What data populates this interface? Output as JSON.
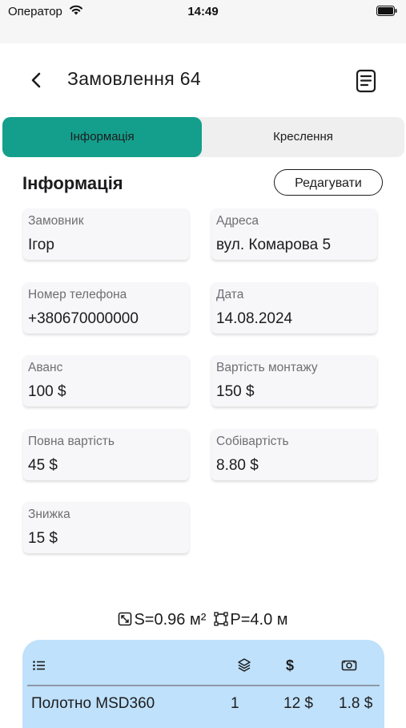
{
  "status_bar": {
    "carrier": "Оператор",
    "time": "14:49"
  },
  "header": {
    "title": "Замовлення 64"
  },
  "tabs": [
    {
      "label": "Інформація",
      "active": true
    },
    {
      "label": "Креслення",
      "active": false
    }
  ],
  "info": {
    "title": "Інформація",
    "edit_label": "Редагувати",
    "fields": {
      "customer": {
        "label": "Замовник",
        "value": "Ігор"
      },
      "address": {
        "label": "Адреса",
        "value": "вул. Комарова 5"
      },
      "phone": {
        "label": "Номер телефона",
        "value": "+380670000000"
      },
      "date": {
        "label": "Дата",
        "value": "14.08.2024"
      },
      "advance": {
        "label": "Аванс",
        "value": "100 $"
      },
      "install_cost": {
        "label": "Вартість монтажу",
        "value": "150 $"
      },
      "total_cost": {
        "label": "Повна вартість",
        "value": "45 $"
      },
      "cost_price": {
        "label": "Собівартість",
        "value": "8.80 $"
      },
      "discount": {
        "label": "Знижка",
        "value": "15 $"
      }
    }
  },
  "metrics": {
    "area": "S=0.96 м²",
    "perimeter": "P=4.0 м"
  },
  "materials_table": {
    "header_icons": [
      "list-icon",
      "layers-icon",
      "dollar-icon",
      "money-icon"
    ],
    "rows": [
      {
        "name": "Полотно MSD360",
        "quantity": "1",
        "price": "12 $",
        "cost": "1.8 $"
      }
    ]
  },
  "colors": {
    "accent": "#149f8c",
    "tab_bg": "#efefef",
    "table_bg": "#bfe1fb",
    "card_bg": "#f7f7fa"
  }
}
